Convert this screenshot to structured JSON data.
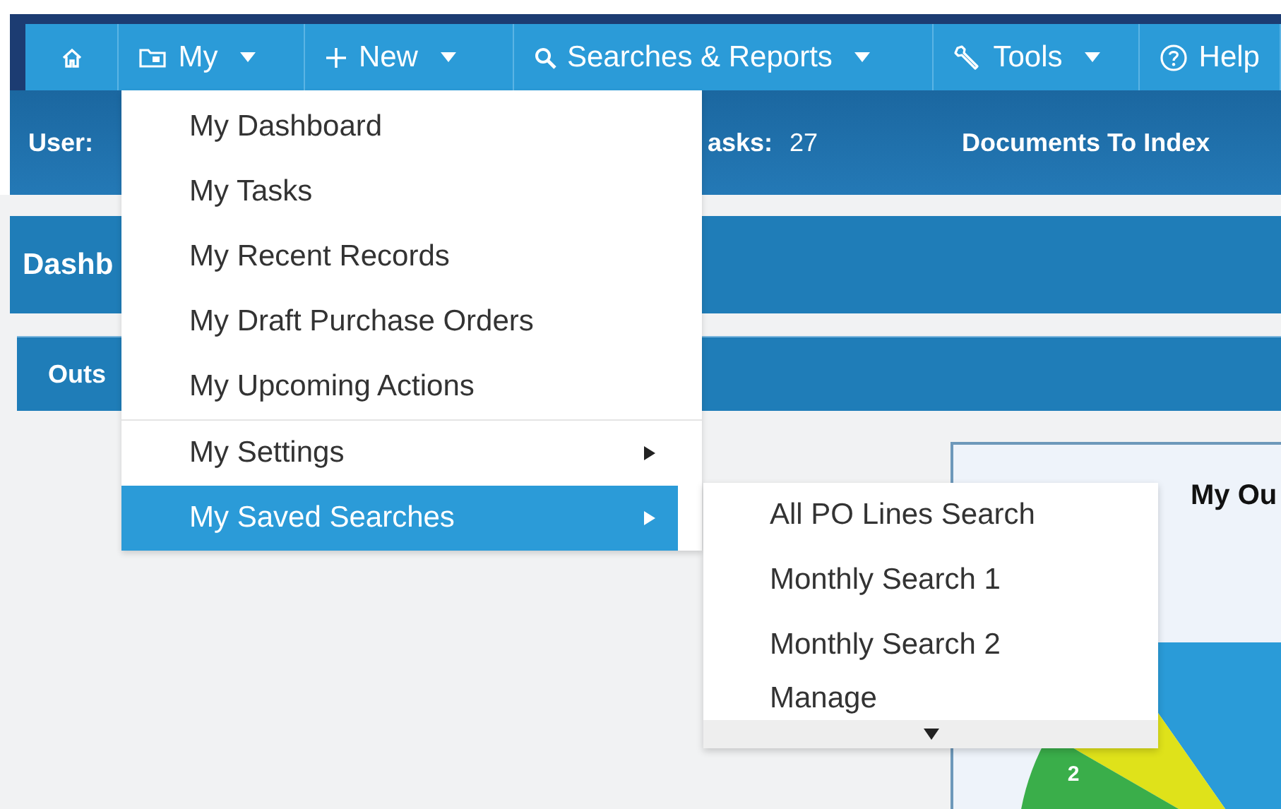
{
  "nav": [
    {
      "kind": "home",
      "caret": false
    },
    {
      "kind": "folder",
      "label": "My",
      "caret": true
    },
    {
      "kind": "plus",
      "label": "New",
      "caret": true
    },
    {
      "kind": "search",
      "label": "Searches & Reports",
      "caret": true
    },
    {
      "kind": "wrench",
      "label": "Tools",
      "caret": true
    },
    {
      "kind": "help",
      "label": "Help",
      "caret": false
    }
  ],
  "info_bar": [
    {
      "label": "User:"
    },
    {
      "label": "asks:",
      "value": "27"
    },
    {
      "label": "Documents To Index"
    }
  ],
  "dashboard_header": "Dashb",
  "section_header": "Outs",
  "chart_panel": {
    "title": "My Ou",
    "slice_label": "2"
  },
  "menu": [
    {
      "label": "My Dashboard",
      "kind": "link",
      "selected": false
    },
    {
      "label": "My Tasks",
      "kind": "link",
      "selected": false
    },
    {
      "label": "My Recent Records",
      "kind": "link",
      "selected": false
    },
    {
      "label": "My Draft Purchase Orders",
      "kind": "link",
      "selected": false
    },
    {
      "label": "My Upcoming Actions",
      "kind": "link",
      "selected": false
    },
    {
      "label": "My Settings",
      "kind": "submenu",
      "selected": false
    },
    {
      "label": "My Saved Searches",
      "kind": "submenu",
      "selected": true
    }
  ],
  "submenu": {
    "items": [
      {
        "label": "All PO Lines Search"
      },
      {
        "label": "Monthly Search 1"
      },
      {
        "label": "Monthly Search 2"
      },
      {
        "label": "Manage"
      }
    ],
    "more_below": true
  }
}
